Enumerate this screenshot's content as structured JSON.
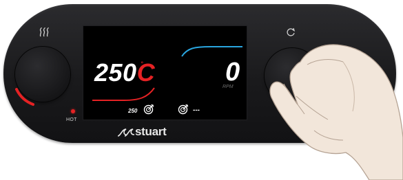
{
  "device": {
    "brand": "stuart",
    "hot_label": "HOT",
    "heat_icon": "heat-waves-icon",
    "rotate_icon": "rotate-icon"
  },
  "display": {
    "temperature": {
      "value": "250",
      "unit": "C",
      "degree": "°",
      "set_value": "250",
      "set_icon": "target-icon"
    },
    "speed": {
      "value": "0",
      "unit": "RPM",
      "set_value": "---",
      "set_icon": "target-icon"
    }
  },
  "colors": {
    "heat_accent": "#e52224",
    "stir_accent": "#2aa6e0",
    "panel": "#1e1e20",
    "screen": "#000000",
    "text": "#ffffff"
  }
}
